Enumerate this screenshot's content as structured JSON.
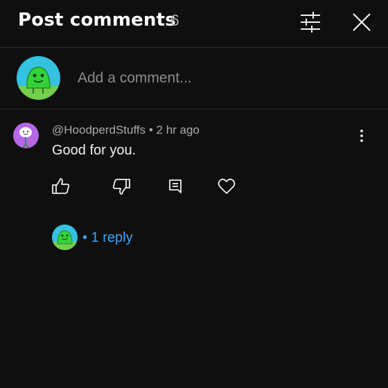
{
  "header": {
    "title": "Post comments",
    "count": "6"
  },
  "composer": {
    "placeholder": "Add a comment..."
  },
  "comments": [
    {
      "author": "@HoodperdStuffs",
      "separator": "•",
      "time": "2 hr ago",
      "text": "Good for you.",
      "replies_label": "• 1 reply"
    }
  ],
  "colors": {
    "background": "#0f0f0f",
    "link": "#3ea6ff",
    "muted_text": "#aaaaaa"
  }
}
